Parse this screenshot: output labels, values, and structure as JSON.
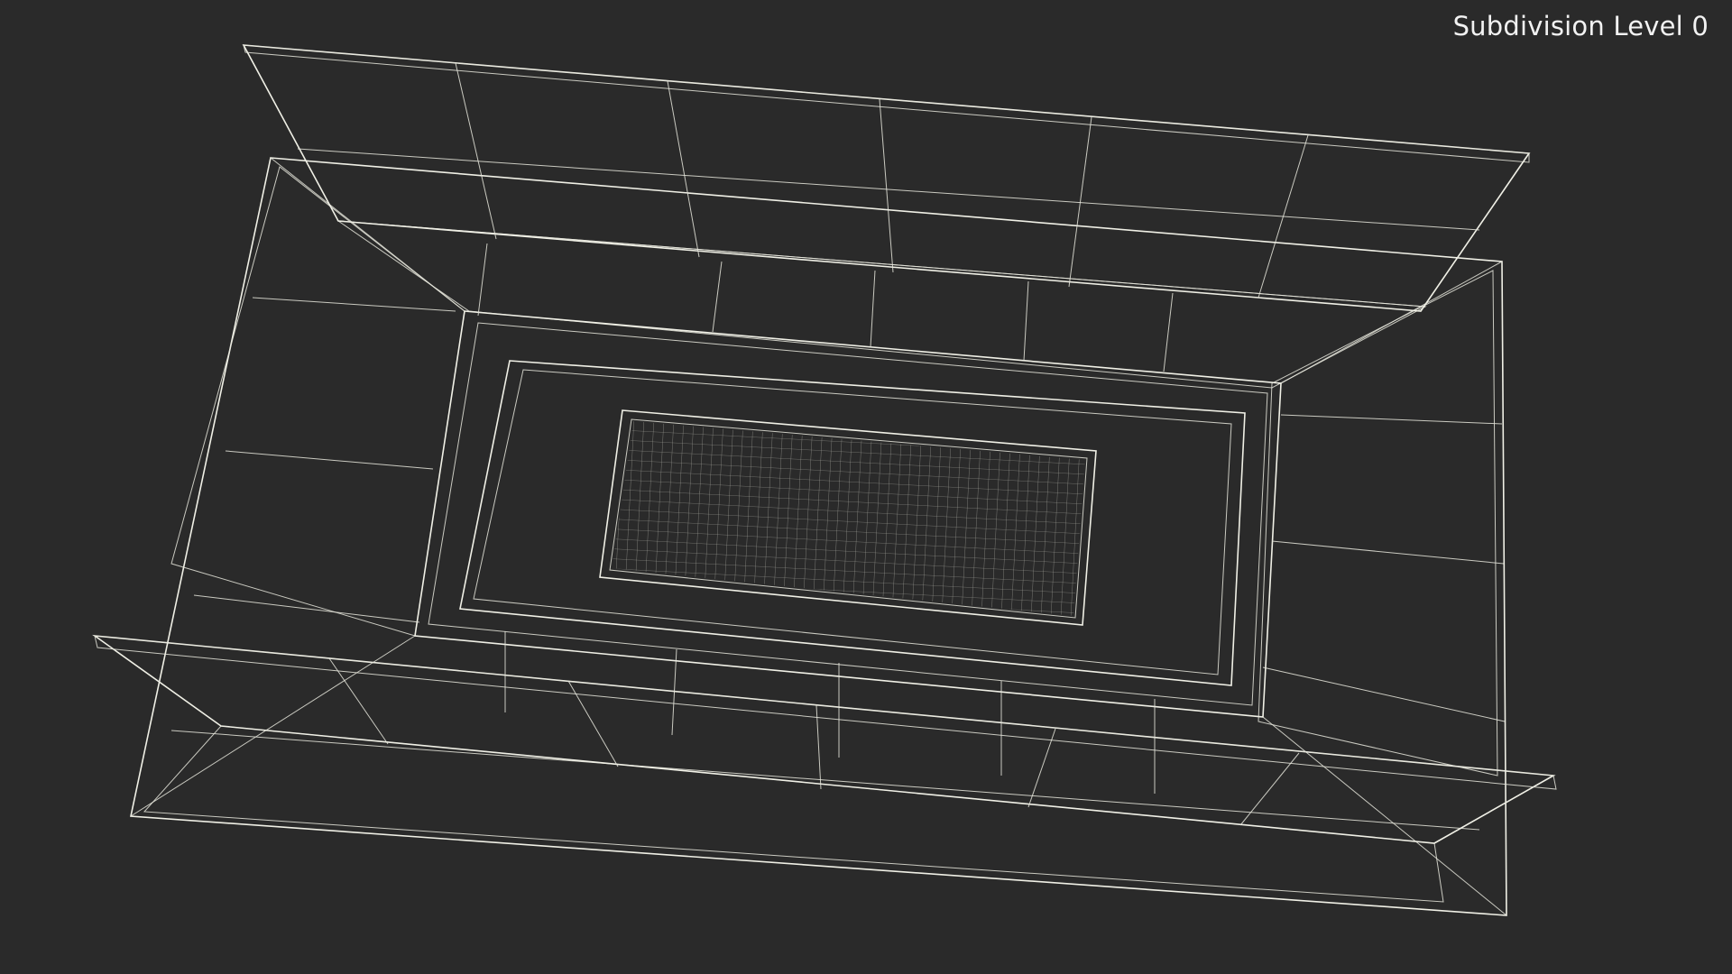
{
  "viewport": {
    "overlay_label": "Subdivision Level 0",
    "background_color": "#2a2a2a",
    "wire_color": "#e6e6dc",
    "surface_color": "#6b6b62"
  },
  "model": {
    "description_icon": "open-box-wireframe"
  }
}
